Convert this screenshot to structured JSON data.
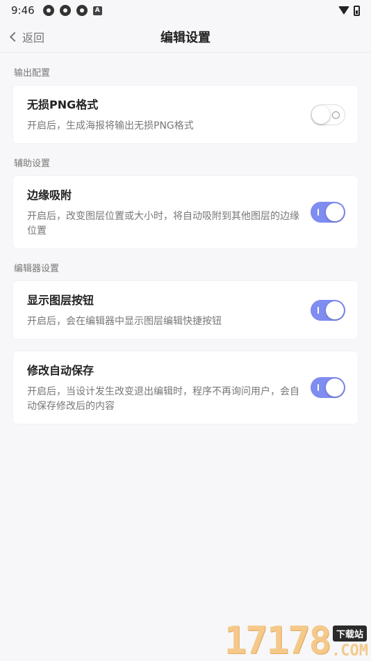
{
  "status_bar": {
    "time": "9:46",
    "badge_letter": "A"
  },
  "header": {
    "back_label": "返回",
    "title": "编辑设置"
  },
  "sections": [
    {
      "label": "输出配置",
      "items": [
        {
          "title": "无损PNG格式",
          "description": "开启后，生成海报将输出无损PNG格式",
          "enabled": false
        }
      ]
    },
    {
      "label": "辅助设置",
      "items": [
        {
          "title": "边缘吸附",
          "description": "开启后，改变图层位置或大小时，将自动吸附到其他图层的边缘位置",
          "enabled": true
        }
      ]
    },
    {
      "label": "编辑器设置",
      "items": [
        {
          "title": "显示图层按钮",
          "description": "开启后，会在编辑器中显示图层编辑快捷按钮",
          "enabled": true
        },
        {
          "title": "修改自动保存",
          "description": "开启后，当设计发生改变退出编辑时，程序不再询问用户，会自动保存修改后的内容",
          "enabled": true
        }
      ]
    }
  ],
  "watermark": {
    "digits": "17178",
    "badge": "下载站",
    "suffix": ".COM"
  },
  "colors": {
    "toggle_on": "#7f8cf0",
    "background": "#f7f7f9"
  }
}
